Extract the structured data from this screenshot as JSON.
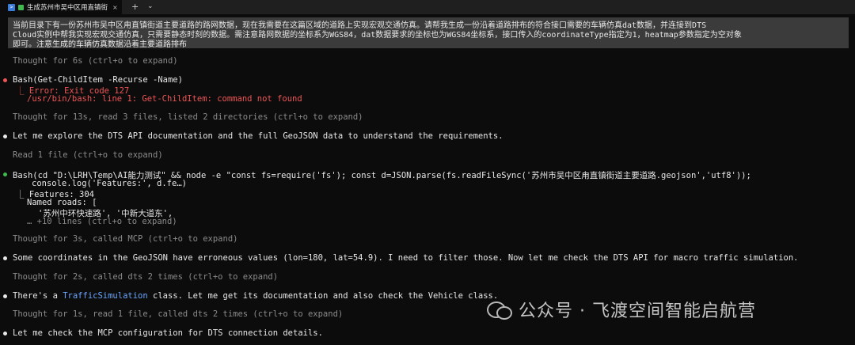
{
  "tab": {
    "title": "生成苏州市吴中区用直镇街道路仿真",
    "close": "×",
    "icon": "terminal-icon"
  },
  "titlebar": {
    "new_tab": "+",
    "dropdown": "⌄"
  },
  "prompt": {
    "line1": "当前目录下有一份苏州市吴中区甪直镇街道主要道路的路网数据，现在我需要在这篇区域的道路上实现宏观交通仿真。请帮我生成一份沿着道路排布的符合接口需要的车辆仿真dat数据，并连接到DTS",
    "line2": "Cloud实例中帮我实现宏观交通仿真，只需要静态时刻的数据。需注意路网数据的坐标系为WGS84，dat数据要求的坐标也为WGS84坐标系，接口传入的coordinateType指定为1，heatmap参数指定为空对象",
    "line3": "即可。注意生成的车辆仿真数据沿着主要道路排布"
  },
  "lines": {
    "t1": "Thought for 6s (ctrl+o to expand)",
    "bash1": "Bash(Get-ChildItem -Recurse -Name)",
    "err1": "⎿  Error: Exit code 127",
    "err2": "/usr/bin/bash: line 1: Get-ChildItem: command not found",
    "t2": "Thought for 13s, read 3 files, listed 2 directories (ctrl+o to expand)",
    "m1": "Let me explore the DTS API documentation and the full GeoJSON data to understand the requirements.",
    "r1": "Read 1 file (ctrl+o to expand)",
    "bash2": "Bash(cd \"D:\\LRH\\Temp\\AI能力测试\" && node -e \"const fs=require('fs'); const d=JSON.parse(fs.readFileSync('苏州市吴中区甪直镇街道主要道路.geojson','utf8'));",
    "bash2b": "console.log('Features:', d.fe…)",
    "o1": "⎿  Features: 304",
    "o2": "Named roads: [",
    "o3": "'苏州中环快速路', '中新大道东',",
    "o4": "… +10 lines (ctrl+o to expand)",
    "t3": "Thought for 3s, called MCP (ctrl+o to expand)",
    "m2": "Some coordinates in the GeoJSON have erroneous values (lon=180, lat=54.9). I need to filter those. Now let me check the DTS API for macro traffic simulation.",
    "t4": "Thought for 2s, called dts 2 times (ctrl+o to expand)",
    "m3a": "There's a ",
    "m3link": "TrafficSimulation",
    "m3b": " class. Let me get its documentation and also check the Vehicle class.",
    "t5": "Thought for 1s, read 1 file, called dts 2 times (ctrl+o to expand)",
    "m4": "Let me check the MCP configuration for DTS connection details."
  },
  "watermark": {
    "text": "公众号 · 飞渡空间智能启航营",
    "icon": "wechat-icon"
  },
  "colors": {
    "error": "#f05555",
    "link": "#6aa6ff",
    "success": "#3fb950",
    "background": "#0c0c0c"
  }
}
